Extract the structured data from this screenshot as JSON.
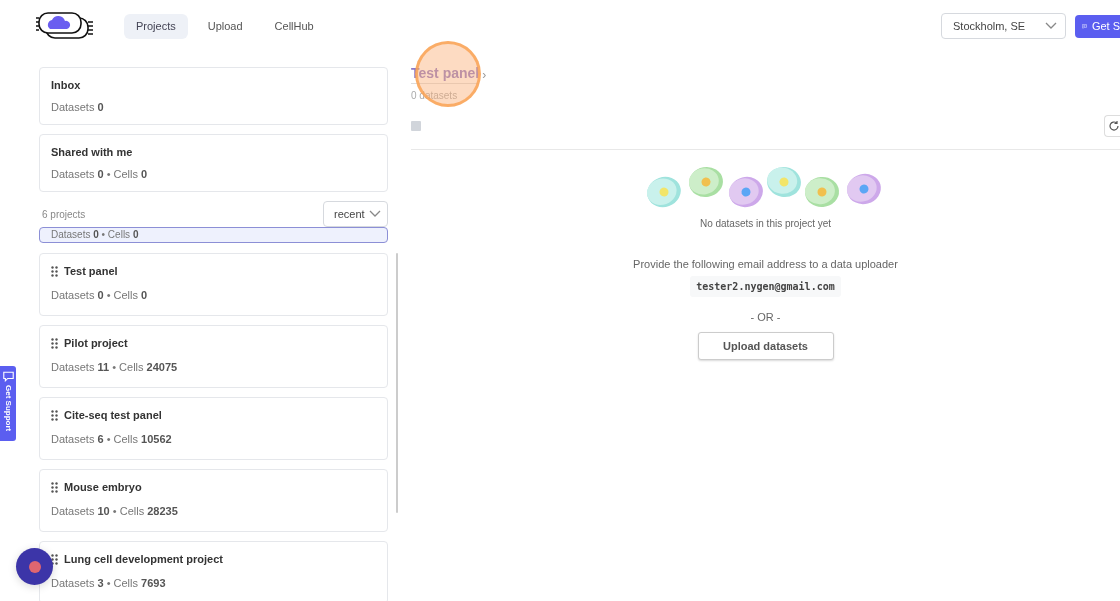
{
  "nav": {
    "tabs": [
      {
        "label": "Projects",
        "selected": true
      },
      {
        "label": "Upload",
        "selected": false
      },
      {
        "label": "CellHub",
        "selected": false
      }
    ],
    "location": "Stockholm, SE",
    "support_button": "Get S"
  },
  "sidebar": {
    "fixed": [
      {
        "title": "Inbox",
        "stats": "Datasets **0**"
      },
      {
        "title": "Shared with me",
        "stats": "Datasets **0** • Cells **0**"
      }
    ],
    "count": "6 projects",
    "sort": "recent",
    "projects": [
      {
        "stats": "Datasets **0** • Cells **0**",
        "selected": true,
        "partial": true
      },
      {
        "title": "Test panel",
        "stats": "Datasets **0** • Cells **0**",
        "selected": false
      },
      {
        "title": "Pilot project",
        "stats": "Datasets **11** • Cells **24075**",
        "selected": false
      },
      {
        "title": "Cite-seq test panel",
        "stats": "Datasets **6** • Cells **10562**",
        "selected": false
      },
      {
        "title": "Mouse embryo",
        "stats": "Datasets **10** • Cells **28235**",
        "selected": false
      },
      {
        "title": "Lung cell development project",
        "stats": "Datasets **3** • Cells **7693**",
        "selected": false
      }
    ]
  },
  "main": {
    "title": "Test panel",
    "separator": "›",
    "subtitle": "0 datasets",
    "select_all_checked": false,
    "empty_text": "No datasets in this project yet",
    "instruction": "Provide the following email address to a data uploader",
    "email": "tester2.nygen@gmail.com",
    "or": "- OR -",
    "upload_button": "Upload datasets"
  },
  "side_tab": "Get Support"
}
